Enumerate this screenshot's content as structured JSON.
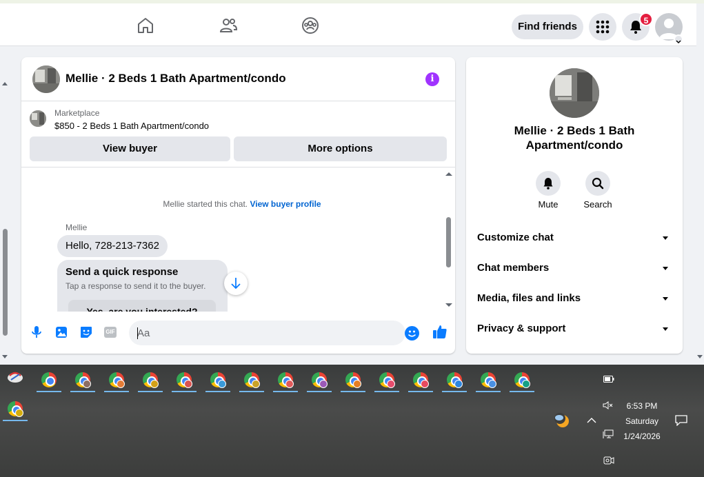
{
  "header": {
    "find_friends": "Find friends",
    "notifications_count": "5",
    "nav_icons": [
      "home-icon",
      "friends-icon",
      "groups-icon"
    ]
  },
  "chat": {
    "title": "Mellie · 2 Beds 1 Bath Apartment/condo",
    "marketplace_label": "Marketplace",
    "listing": "$850 - 2 Beds 1 Bath Apartment/condo",
    "view_buyer": "View buyer",
    "more_options": "More options",
    "system_note": "Mellie started this chat.",
    "system_link": "View buyer profile",
    "sender": "Mellie",
    "message": "Hello, 728-213-7362",
    "quick_title": "Send a quick response",
    "quick_sub": "Tap a response to send it to the buyer.",
    "quick_reply": "Yes, are you interested?",
    "input_placeholder": "Aa",
    "gif_label": "GIF"
  },
  "info_panel": {
    "title": "Mellie · 2 Beds 1 Bath Apartment/condo",
    "actions": [
      "Mute",
      "Search"
    ],
    "sections": [
      "Customize chat",
      "Chat members",
      "Media, files and links",
      "Privacy & support"
    ]
  },
  "taskbar": {
    "time": "6:53 PM",
    "day": "Saturday",
    "date": "1/24/2026"
  },
  "colors": {
    "accent": "#0a7cff",
    "info_icon": "#a033ff",
    "badge": "#e41e3f",
    "link": "#0064d1"
  }
}
